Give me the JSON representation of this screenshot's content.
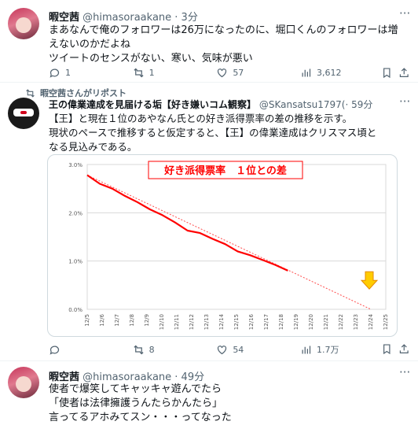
{
  "tweet1": {
    "name": "暇空茜",
    "handle": "@himasoraakane · 3分",
    "lines": [
      "まあなんで俺のフォロワーは26万になったのに、堀口くんのフォロワーは増",
      "えないのかだよね",
      "ツイートのセンスがない、寒い、気味が悪い"
    ],
    "replies": "1",
    "reposts": "1",
    "likes": "57",
    "views": "3,612"
  },
  "tweet2": {
    "repost_label": "暇空茜さんがリポスト",
    "name": "王の偉業達成を見届ける垢【好き嫌いコム観察】",
    "handle": "@SKansatsu1797(",
    "time": "· 59分",
    "lines": [
      "【王】と現在１位のあやなん氏との好き派得票率の差の推移を示す。",
      "現状のペースで推移すると仮定すると、【王】の偉業達成はクリスマス頃と",
      "なる見込みである。"
    ],
    "replies": "",
    "reposts": "8",
    "likes": "54",
    "views": "1.7万"
  },
  "tweet3": {
    "name": "暇空茜",
    "handle": "@himasoraakane · 49分",
    "lines": [
      "使者で爆笑してキャッキャ遊んでたら",
      "「使者は法律擁護うんたらかんたら」",
      "言ってるアホみてスン・・・ってなった"
    ]
  },
  "colors": {
    "accent": "#ff0000",
    "text": "#0f1419",
    "muted": "#536471",
    "arrow": "#ffcc00"
  },
  "chart_data": {
    "type": "line",
    "title": "好き派得票率　１位との差",
    "x": [
      "12/5",
      "12/6",
      "12/7",
      "12/8",
      "12/9",
      "12/10",
      "12/11",
      "12/12",
      "12/13",
      "12/14",
      "12/15",
      "12/16",
      "12/17",
      "12/18",
      "12/19",
      "12/20",
      "12/21",
      "12/22",
      "12/23",
      "12/24",
      "12/25"
    ],
    "y_ticks": [
      "3.0%",
      "2.0%",
      "1.0%",
      "0.0%"
    ],
    "ylim": [
      0,
      3.0
    ],
    "series": [
      {
        "values": [
          2.78,
          2.6,
          2.5,
          2.35,
          2.22,
          2.07,
          1.95,
          1.8,
          1.63,
          1.58,
          1.46,
          1.35,
          1.2,
          1.12,
          1.02,
          0.92,
          0.8
        ]
      }
    ],
    "trend": {
      "x_start": "12/5",
      "y_start": 2.78,
      "x_end": "12/24",
      "y_end": 0.0
    },
    "annotation": "down-arrow at 12/24"
  }
}
